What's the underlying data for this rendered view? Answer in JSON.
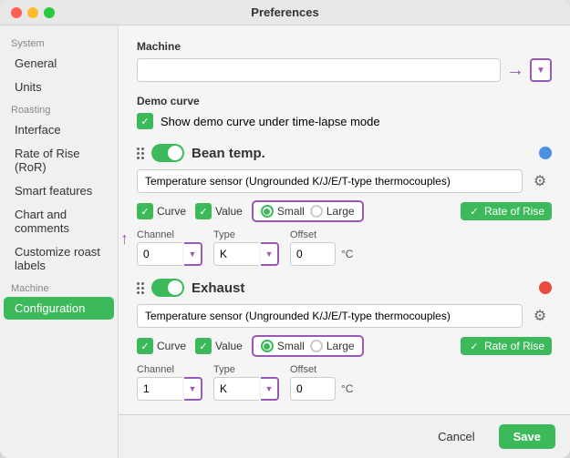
{
  "window": {
    "title": "Preferences"
  },
  "sidebar": {
    "system_label": "System",
    "machine_label": "Machine",
    "roasting_label": "Roasting",
    "items": [
      {
        "id": "general",
        "label": "General"
      },
      {
        "id": "units",
        "label": "Units"
      },
      {
        "id": "interface",
        "label": "Interface"
      },
      {
        "id": "rate-of-rise",
        "label": "Rate of Rise (RoR)"
      },
      {
        "id": "smart-features",
        "label": "Smart features"
      },
      {
        "id": "chart-comments",
        "label": "Chart and comments"
      },
      {
        "id": "customize-roast",
        "label": "Customize roast labels"
      },
      {
        "id": "configuration",
        "label": "Configuration"
      }
    ]
  },
  "main": {
    "machine_section": "Machine",
    "machine_input_value": "",
    "demo_curve_section": "Demo curve",
    "demo_curve_label": "Show demo curve under time-lapse mode",
    "bean_temp_label": "Bean temp.",
    "bean_temp_sensor": "Temperature sensor (Ungrounded K/J/E/T-type thermocouples)",
    "bean_temp_size_small": "Small",
    "bean_temp_size_large": "Large",
    "bean_temp_rate_of_rise": "Rate of Rise",
    "bean_channel_label": "Channel",
    "bean_channel_value": "0",
    "bean_type_label": "Type",
    "bean_type_value": "K",
    "bean_offset_label": "Offset",
    "bean_offset_value": "0",
    "bean_unit": "°C",
    "exhaust_label": "Exhaust",
    "exhaust_sensor": "Temperature sensor (Ungrounded K/J/E/T-type thermocouples)",
    "exhaust_size_small": "Small",
    "exhaust_size_large": "Large",
    "exhaust_rate_of_rise": "Rate of Rise",
    "exhaust_channel_label": "Channel",
    "exhaust_channel_value": "1",
    "exhaust_type_label": "Type",
    "exhaust_type_value": "K",
    "exhaust_offset_label": "Offset",
    "exhaust_offset_value": "0",
    "exhaust_unit": "°C"
  },
  "footer": {
    "cancel_label": "Cancel",
    "save_label": "Save"
  },
  "colors": {
    "green": "#3cb95a",
    "purple": "#9b59b6",
    "blue_dot": "#4a90e2",
    "red_dot": "#e74c3c"
  }
}
